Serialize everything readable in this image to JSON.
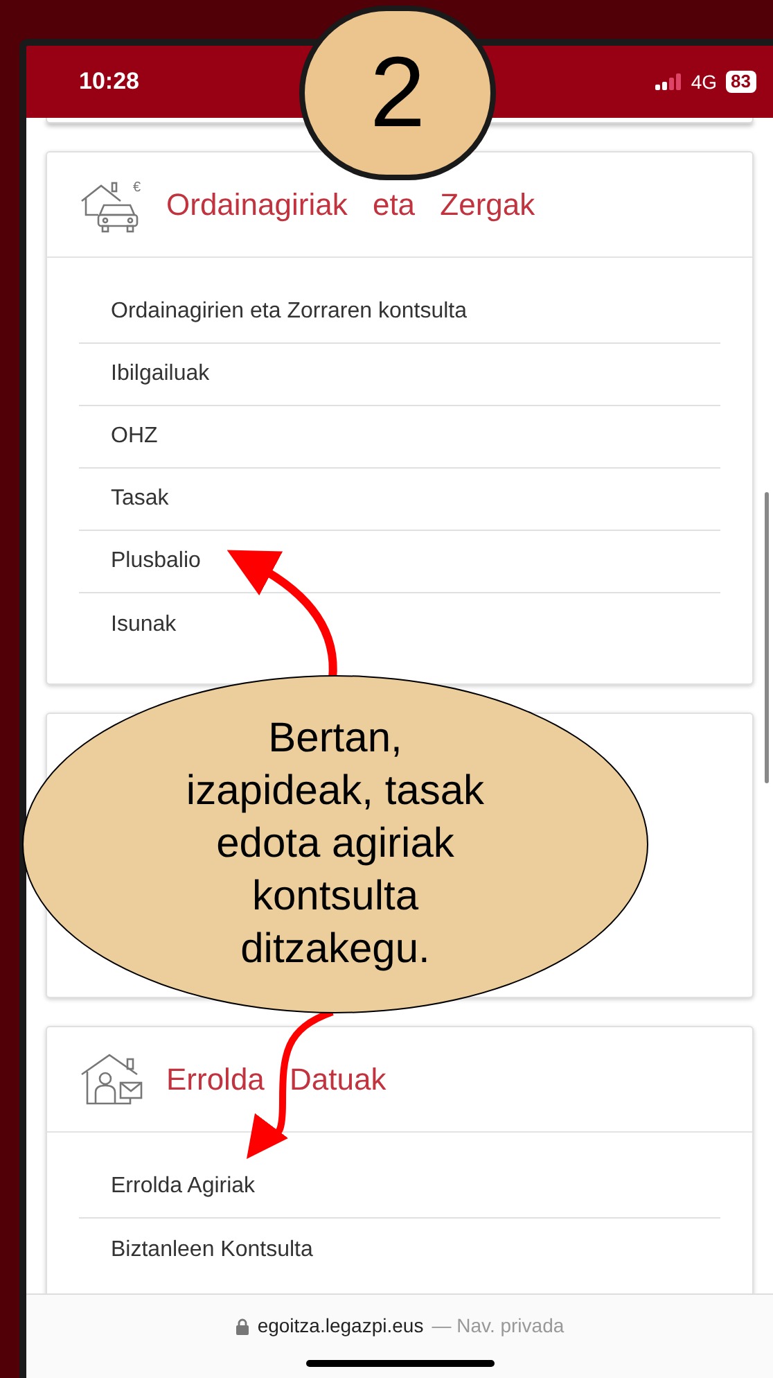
{
  "status_bar": {
    "time": "10:28",
    "network": "4G",
    "battery": "83"
  },
  "step_badge": "2",
  "sections": [
    {
      "kind": "house-car",
      "icon_label": "€",
      "title": "Ordainagiriak eta Zergak",
      "items": [
        "Ordainagirien eta Zorraren kontsulta",
        "Ibilgailuak",
        "OHZ",
        "Tasak",
        "Plusbalio",
        "Isunak"
      ]
    },
    {
      "kind": "blank"
    },
    {
      "kind": "house-person",
      "title": "Errolda Datuak",
      "items": [
        "Errolda Agiriak",
        "Biztanleen Kontsulta"
      ]
    }
  ],
  "callout": {
    "lines": [
      "Bertan,",
      "izapideak, tasak",
      "edota agiriak",
      "kontsulta",
      "ditzakegu."
    ]
  },
  "url_bar": {
    "domain": "egoitza.legazpi.eus",
    "suffix": "— Nav. privada"
  }
}
